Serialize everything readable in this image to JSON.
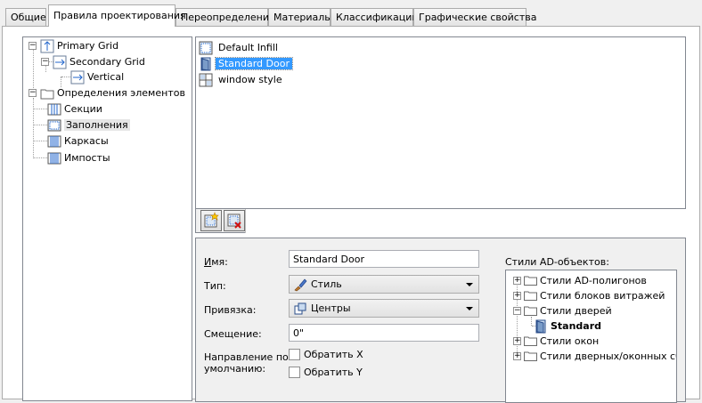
{
  "tabs": [
    "Общие",
    "Правила проектирования",
    "Переопределения",
    "Материалы",
    "Классификации",
    "Графические свойства"
  ],
  "active_tab": "Правила проектирования",
  "left_tree": {
    "primary_grid": "Primary Grid",
    "secondary_grid": "Secondary Grid",
    "vertical": "Vertical",
    "element_definitions": "Определения элементов",
    "sections": "Секции",
    "infills": "Заполнения",
    "frames": "Каркасы",
    "mullions": "Импосты"
  },
  "style_list": {
    "items": [
      "Default Infill",
      "Standard Door",
      "window style"
    ],
    "selected": "Standard Door"
  },
  "toolbar": {
    "new_icon": "new-style-icon",
    "delete_icon": "delete-style-icon"
  },
  "props": {
    "name_label": "Имя:",
    "name_value": "Standard Door",
    "type_label": "Тип:",
    "type_value": "Стиль",
    "snap_label": "Привязка:",
    "snap_value": "Центры",
    "offset_label": "Смещение:",
    "offset_value": "0\"",
    "direction_label_1": "Направление по",
    "direction_label_2": "умолчанию:",
    "flip_x": "Обратить X",
    "flip_y": "Обратить Y"
  },
  "ad_styles": {
    "title": "Стили AD-объектов:",
    "items": [
      "Стили AD-полигонов",
      "Стили блоков витражей",
      "Стили дверей",
      "Standard",
      "Стили окон",
      "Стили дверных/оконных сбо"
    ]
  }
}
